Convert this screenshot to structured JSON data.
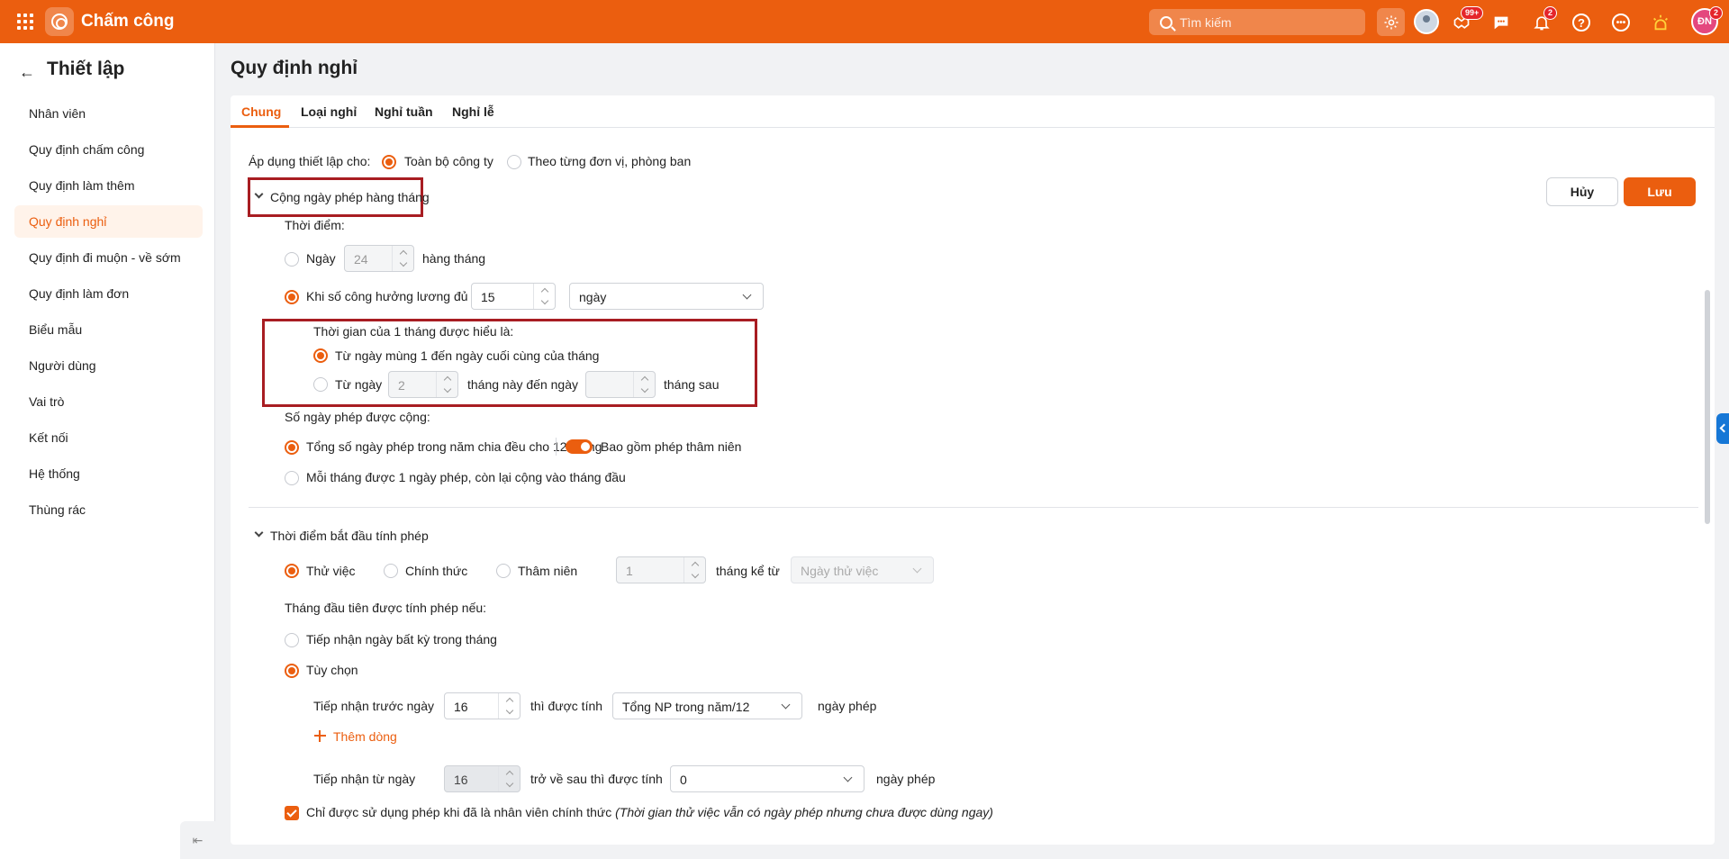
{
  "app": {
    "title": "Chấm công"
  },
  "search": {
    "placeholder": "Tìm kiếm"
  },
  "notifications": {
    "tasks_badge": "99+",
    "bell_badge": "2",
    "user_badge": "2",
    "user_initials": "ĐN"
  },
  "colors": {
    "brand": "#eb5e0f",
    "danger_box": "#a81d22"
  },
  "icons": [
    "apps-grid-icon",
    "fingerprint-icon",
    "search-icon",
    "gear-icon",
    "handshake-icon",
    "chat-icon",
    "bell-icon",
    "help-icon",
    "more-icon",
    "lamp-icon"
  ],
  "sidebar": {
    "title": "Thiết lập",
    "items": [
      {
        "label": "Nhân viên"
      },
      {
        "label": "Quy định chấm công"
      },
      {
        "label": "Quy định làm thêm"
      },
      {
        "label": "Quy định nghỉ",
        "active": true
      },
      {
        "label": "Quy định đi muộn - về sớm"
      },
      {
        "label": "Quy định làm đơn"
      },
      {
        "label": "Biểu mẫu"
      },
      {
        "label": "Người dùng"
      },
      {
        "label": "Vai trò"
      },
      {
        "label": "Kết nối"
      },
      {
        "label": "Hệ thống"
      },
      {
        "label": "Thùng rác"
      }
    ]
  },
  "page": {
    "title": "Quy định nghỉ"
  },
  "tabs": [
    {
      "label": "Chung",
      "active": true
    },
    {
      "label": "Loại nghỉ"
    },
    {
      "label": "Nghỉ tuần"
    },
    {
      "label": "Nghỉ lễ"
    }
  ],
  "apply": {
    "label": "Áp dụng thiết lập cho:",
    "option_company": "Toàn bộ công ty",
    "option_unit": "Theo từng đơn vị, phòng ban",
    "selected": "company"
  },
  "buttons": {
    "cancel": "Hủy",
    "save": "Lưu"
  },
  "monthly": {
    "section_title": "Cộng ngày phép hàng tháng",
    "time_label": "Thời điểm:",
    "day_option": "Ngày",
    "day_value": "24",
    "day_suffix": "hàng tháng",
    "when_option": "Khi số công hưởng lương đủ",
    "when_value": "15",
    "when_unit": "ngày",
    "month_def_label": "Thời gian của 1 tháng được hiểu là:",
    "month_def_opt1": "Từ ngày mùng 1 đến ngày cuối cùng của tháng",
    "month_def_opt2_prefix": "Từ ngày",
    "month_def_opt2_value": "2",
    "month_def_opt2_mid": "tháng này đến ngày",
    "month_def_opt2_value2": "",
    "month_def_opt2_suffix": "tháng sau",
    "days_added_label": "Số ngày phép được cộng:",
    "days_opt1": "Tổng số ngày phép trong năm chia đều cho 12 tháng",
    "seniority_toggle": "Bao gồm phép thâm niên",
    "seniority_on": true,
    "days_opt2": "Mỗi tháng được 1 ngày phép, còn lại cộng vào tháng đầu"
  },
  "start": {
    "section_title": "Thời điểm bắt đầu tính phép",
    "opt_probation": "Thử việc",
    "opt_official": "Chính thức",
    "opt_seniority": "Thâm niên",
    "seniority_value": "1",
    "months_from": "tháng kể từ",
    "from_select": "Ngày thử việc",
    "first_month_label": "Tháng đầu tiên được tính phép nếu:",
    "any_day": "Tiếp nhận ngày bất kỳ trong tháng",
    "custom": "Tùy chọn",
    "before_label": "Tiếp nhận trước ngày",
    "before_value": "16",
    "counted_label": "thì được tính",
    "counted_select": "Tổng NP trong năm/12",
    "leave_days": "ngày phép",
    "add_row": "Thêm dòng",
    "from_label": "Tiếp nhận từ ngày",
    "from_value": "16",
    "after_label": "trở về sau thì được tính",
    "after_select": "0",
    "leave_days2": "ngày phép",
    "official_only": "Chỉ được sử dụng phép khi đã là nhân viên chính thức",
    "official_note": "(Thời gian thử việc vẫn có ngày phép nhưng chưa được dùng ngay)"
  }
}
